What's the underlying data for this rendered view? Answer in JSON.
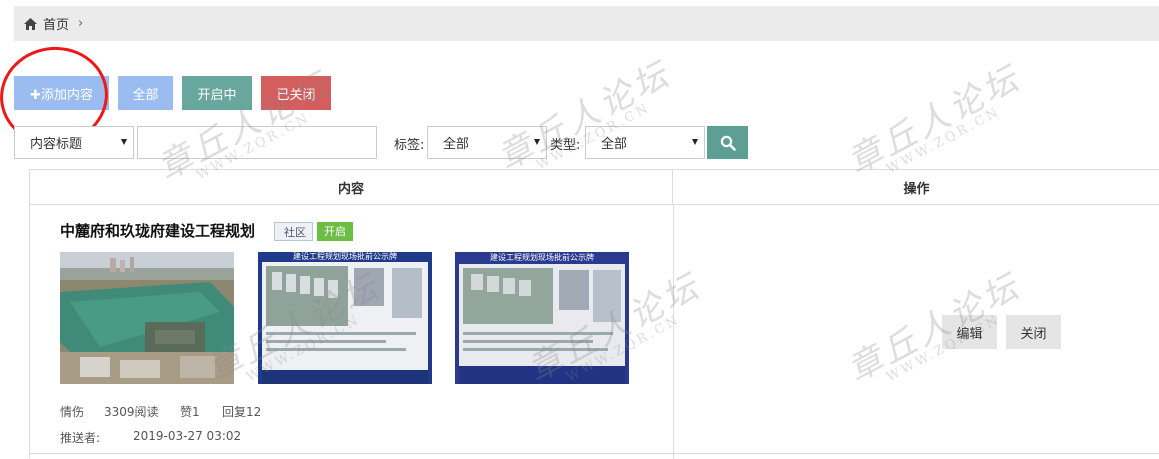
{
  "breadcrumb": {
    "home_label": "首页",
    "separator": "›"
  },
  "toolbar": {
    "add_label": "✚添加内容",
    "all_label": "全部",
    "open_label": "开启中",
    "closed_label": "已关闭"
  },
  "filters": {
    "field_select": "内容标题",
    "keyword_value": "",
    "tag_label": "标签:",
    "tag_select": "全部",
    "type_label": "类型:",
    "type_select": "全部"
  },
  "table": {
    "headers": {
      "content": "内容",
      "operations": "操作"
    },
    "rows": [
      {
        "title": "中麓府和玖珑府建设工程规划",
        "tag": "社区",
        "status": "开启",
        "author": "情伤",
        "reads": "3309阅读",
        "likes": "赞1",
        "replies": "回复12",
        "pusher_label": "推送者:",
        "date": "2019-03-27 03:02",
        "board_title": "建设工程规划现场批前公示牌",
        "edit_label": "编辑",
        "close_label": "关闭"
      }
    ]
  },
  "watermark": {
    "text": "章丘人论坛",
    "url": "WWW.ZQR.CN"
  },
  "colors": {
    "accent_blue": "#9bbcf0",
    "teal": "#68a79d",
    "red": "#d45d5d",
    "green_badge": "#6dbd45",
    "annotation": "#f01717"
  }
}
